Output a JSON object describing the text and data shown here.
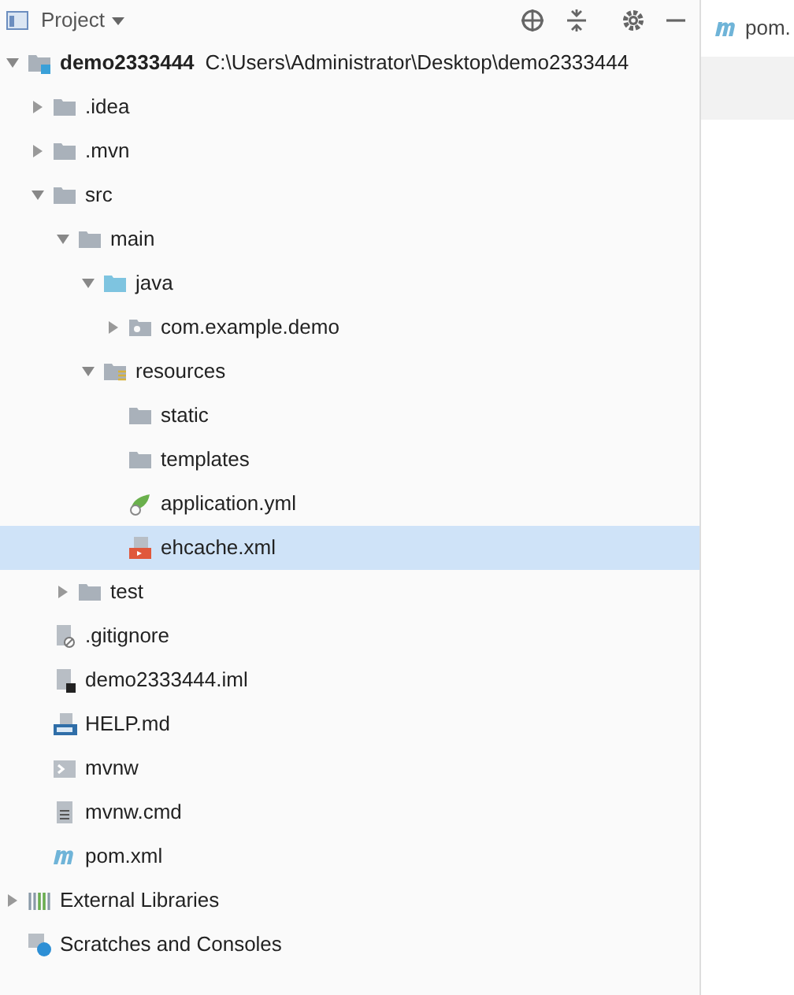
{
  "panel": {
    "title": "Project"
  },
  "tree": [
    {
      "label": "demo2333444",
      "path": "C:\\Users\\Administrator\\Desktop\\demo2333444",
      "kind": "module",
      "expanded": true,
      "selected": false,
      "children": [
        {
          "label": ".idea",
          "kind": "folder",
          "expanded": false,
          "selected": false
        },
        {
          "label": ".mvn",
          "kind": "folder",
          "expanded": false,
          "selected": false
        },
        {
          "label": "src",
          "kind": "folder",
          "expanded": true,
          "selected": false,
          "children": [
            {
              "label": "main",
              "kind": "folder",
              "expanded": true,
              "selected": false,
              "children": [
                {
                  "label": "java",
                  "kind": "source",
                  "expanded": true,
                  "selected": false,
                  "children": [
                    {
                      "label": "com.example.demo",
                      "kind": "package",
                      "expanded": false,
                      "selected": false
                    }
                  ]
                },
                {
                  "label": "resources",
                  "kind": "resources",
                  "expanded": true,
                  "selected": false,
                  "children": [
                    {
                      "label": "static",
                      "kind": "folder",
                      "selected": false
                    },
                    {
                      "label": "templates",
                      "kind": "folder",
                      "selected": false
                    },
                    {
                      "label": "application.yml",
                      "kind": "yml",
                      "selected": false
                    },
                    {
                      "label": "ehcache.xml",
                      "kind": "xml",
                      "selected": true
                    }
                  ]
                }
              ]
            },
            {
              "label": "test",
              "kind": "folder",
              "expanded": false,
              "selected": false
            }
          ]
        },
        {
          "label": ".gitignore",
          "kind": "gitignore",
          "selected": false
        },
        {
          "label": "demo2333444.iml",
          "kind": "iml",
          "selected": false
        },
        {
          "label": "HELP.md",
          "kind": "md",
          "selected": false
        },
        {
          "label": "mvnw",
          "kind": "script",
          "selected": false
        },
        {
          "label": "mvnw.cmd",
          "kind": "cmd",
          "selected": false
        },
        {
          "label": "pom.xml",
          "kind": "maven",
          "selected": false
        }
      ]
    },
    {
      "label": "External Libraries",
      "kind": "libraries",
      "expanded": false,
      "selected": false
    },
    {
      "label": "Scratches and Consoles",
      "kind": "scratches",
      "selected": false
    }
  ],
  "editor": {
    "tab": {
      "label": "pom."
    }
  }
}
